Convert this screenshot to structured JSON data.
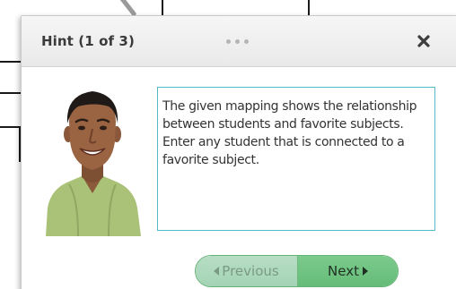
{
  "dialog": {
    "title": "Hint (1 of 3)",
    "close_icon": "close-x-icon",
    "drag_icon": "drag-handle-dots-icon"
  },
  "hint": {
    "text": "The given mapping shows the relationship between students and favorite subjects. Enter any student that is connected to a favorite subject."
  },
  "avatar": {
    "icon": "tutor-avatar-illustration"
  },
  "navigation": {
    "previous_label": "Previous",
    "next_label": "Next",
    "previous_icon": "chevron-left-icon",
    "next_icon": "chevron-right-icon"
  },
  "colors": {
    "hint_border": "#55b8c6",
    "next_button": "#6fc282",
    "previous_button_disabled": "#aed8bc"
  }
}
